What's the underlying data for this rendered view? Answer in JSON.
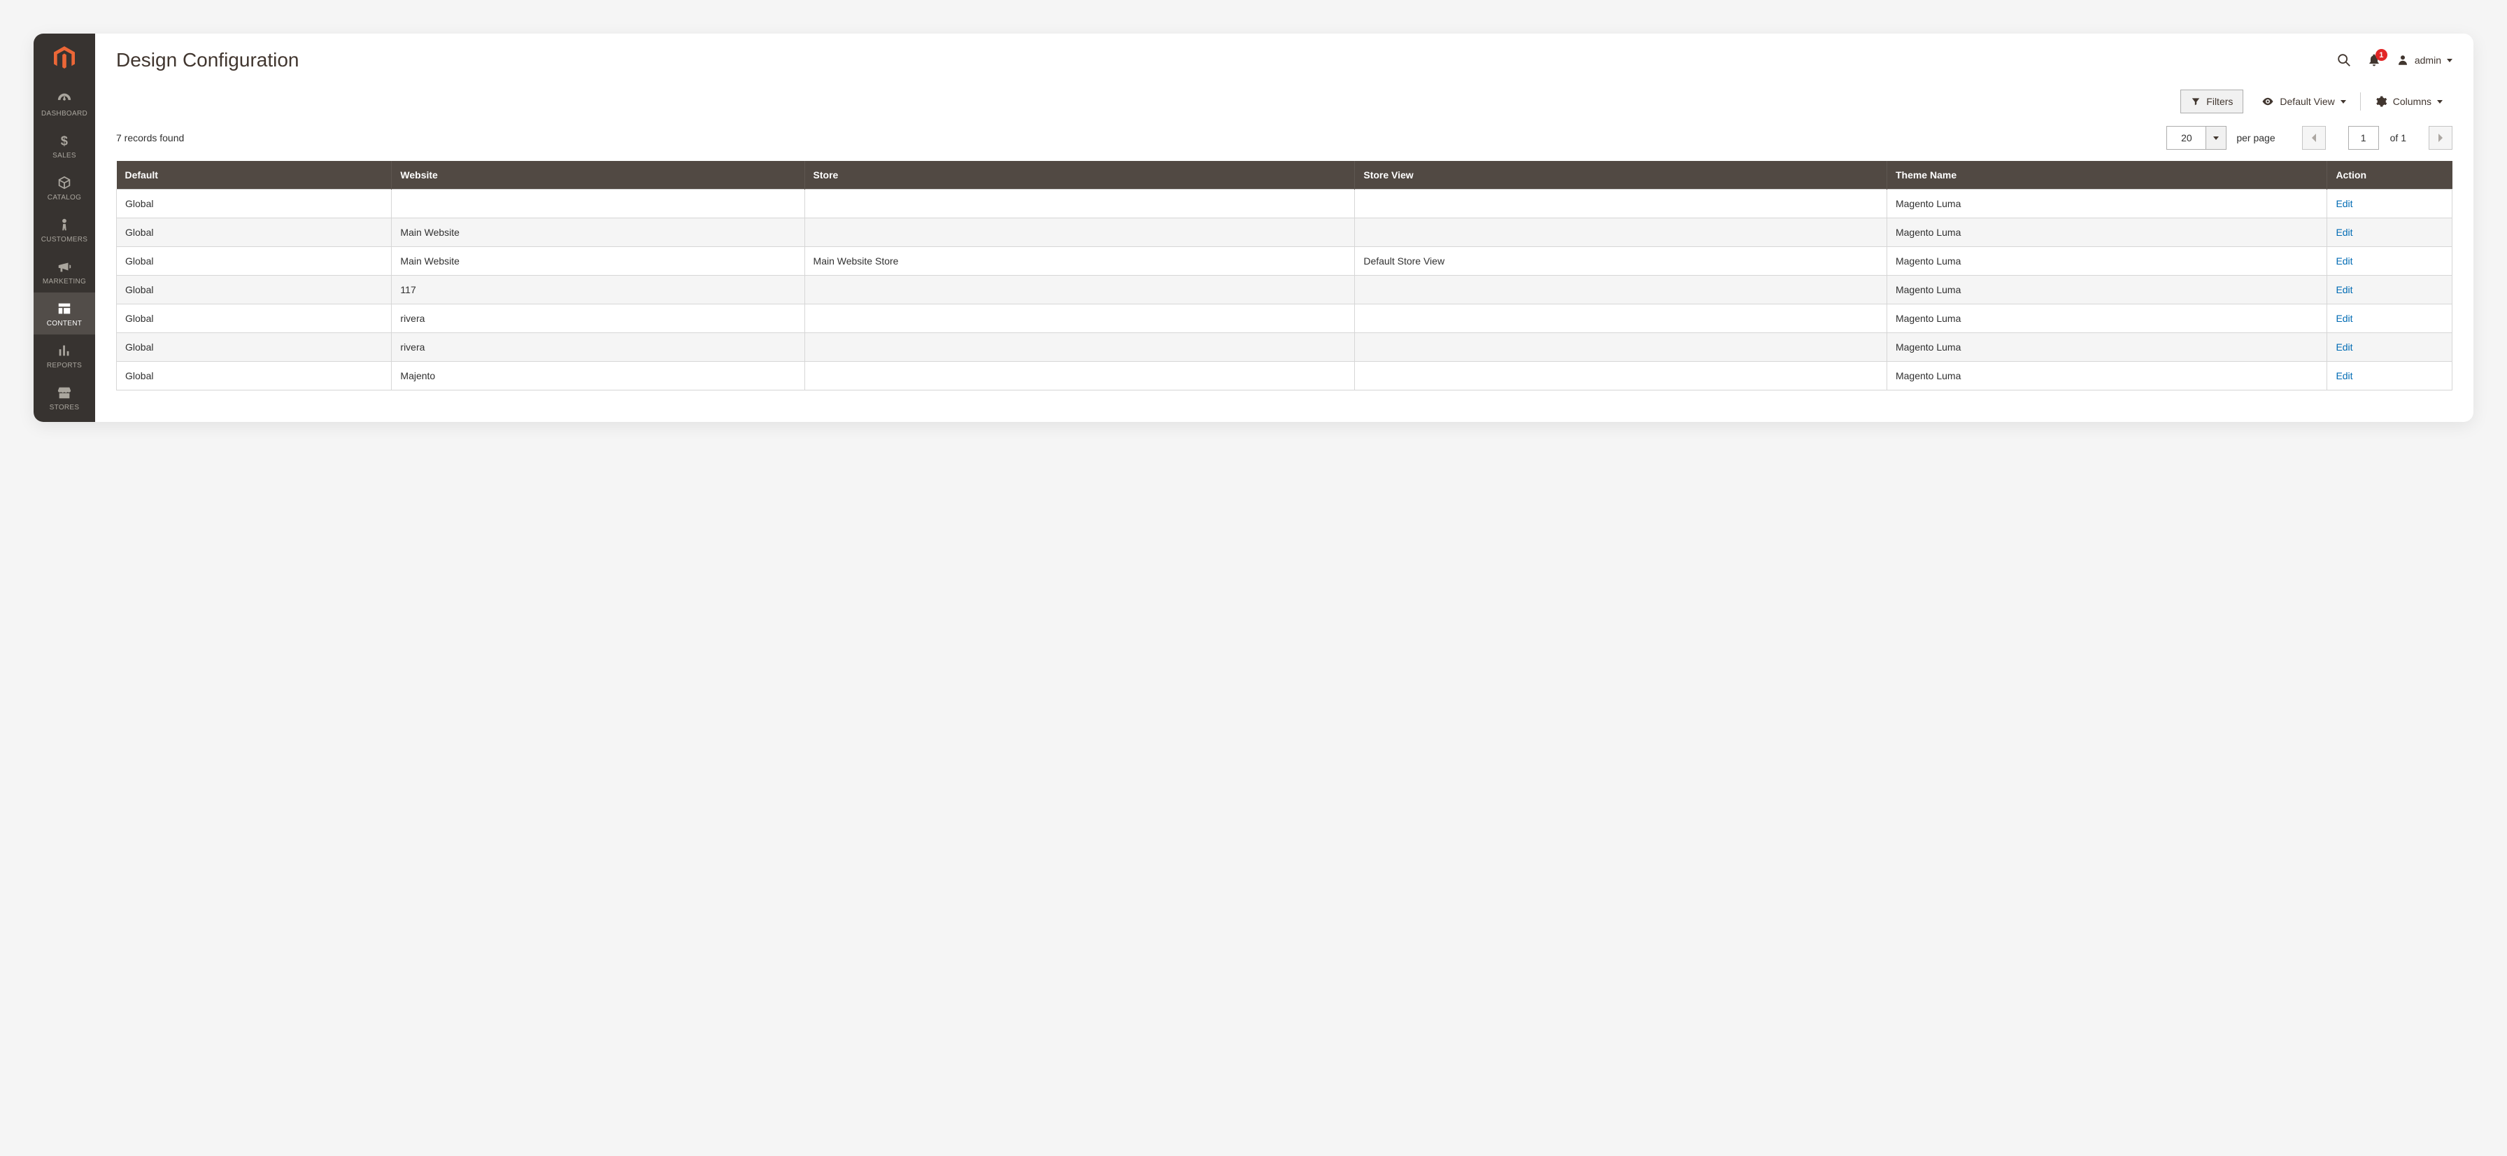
{
  "page": {
    "title": "Design Configuration"
  },
  "sidebar": {
    "items": [
      {
        "name": "dashboard",
        "label": "DASHBOARD"
      },
      {
        "name": "sales",
        "label": "SALES"
      },
      {
        "name": "catalog",
        "label": "CATALOG"
      },
      {
        "name": "customers",
        "label": "CUSTOMERS"
      },
      {
        "name": "marketing",
        "label": "MARKETING"
      },
      {
        "name": "content",
        "label": "CONTENT"
      },
      {
        "name": "reports",
        "label": "REPORTS"
      },
      {
        "name": "stores",
        "label": "STORES"
      }
    ]
  },
  "header": {
    "notification_count": "1",
    "username": "admin"
  },
  "toolbar": {
    "filters_label": "Filters",
    "default_view_label": "Default View",
    "columns_label": "Columns"
  },
  "grid": {
    "records_found": "7 records found",
    "page_size": "20",
    "per_page_label": "per page",
    "current_page": "1",
    "of_label": "of 1",
    "columns": {
      "default": "Default",
      "website": "Website",
      "store": "Store",
      "store_view": "Store View",
      "theme_name": "Theme Name",
      "action": "Action"
    },
    "action_label": "Edit",
    "rows": [
      {
        "default": "Global",
        "website": "",
        "store": "",
        "store_view": "",
        "theme_name": "Magento Luma"
      },
      {
        "default": "Global",
        "website": "Main Website",
        "store": "",
        "store_view": "",
        "theme_name": "Magento Luma"
      },
      {
        "default": "Global",
        "website": "Main Website",
        "store": "Main Website Store",
        "store_view": "Default Store View",
        "theme_name": "Magento Luma"
      },
      {
        "default": "Global",
        "website": "117",
        "store": "",
        "store_view": "",
        "theme_name": "Magento Luma"
      },
      {
        "default": "Global",
        "website": "rivera",
        "store": "",
        "store_view": "",
        "theme_name": "Magento Luma"
      },
      {
        "default": "Global",
        "website": "rivera",
        "store": "",
        "store_view": "",
        "theme_name": "Magento Luma"
      },
      {
        "default": "Global",
        "website": "Majento",
        "store": "",
        "store_view": "",
        "theme_name": "Magento Luma"
      }
    ]
  }
}
